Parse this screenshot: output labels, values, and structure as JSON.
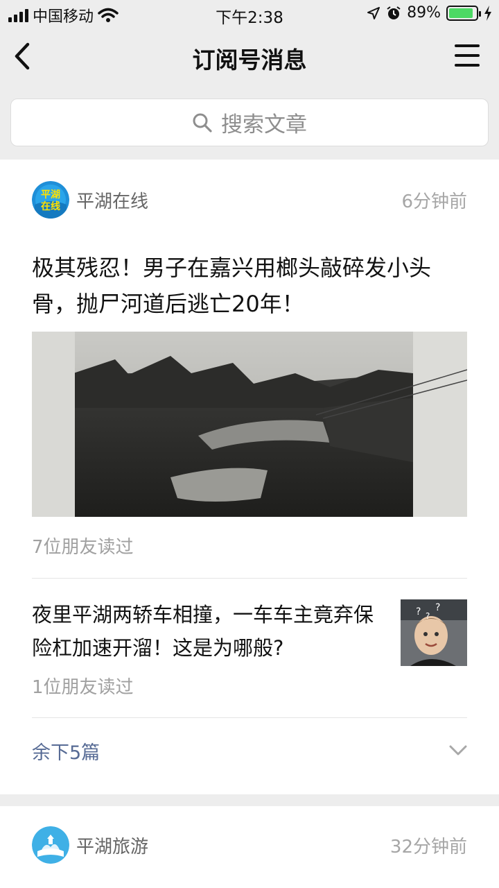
{
  "status_bar": {
    "carrier": "中国移动",
    "time": "下午2:38",
    "battery_percent": "89%",
    "battery_level": 0.89
  },
  "nav": {
    "title": "订阅号消息"
  },
  "search": {
    "placeholder": "搜索文章"
  },
  "feed": [
    {
      "account_name": "平湖在线",
      "time_ago": "6分钟前",
      "headline": "极其残忍！男子在嘉兴用榔头敲碎发小头骨，抛尸河道后逃亡20年！",
      "read_count": "7位朋友读过",
      "sub_article": {
        "title": "夜里平湖两轿车相撞，一车车主竟弃保险杠加速开溜！这是为哪般?",
        "read_count": "1位朋友读过"
      },
      "more_label": "余下5篇"
    },
    {
      "account_name": "平湖旅游",
      "time_ago": "32分钟前"
    }
  ],
  "icons": [
    "signal-icon",
    "wifi-icon",
    "location-icon",
    "alarm-icon",
    "battery-icon",
    "charging-icon",
    "back-icon",
    "menu-icon",
    "search-icon",
    "chevron-down-icon"
  ],
  "colors": {
    "background": "#ededed",
    "link": "#576b95",
    "battery": "#4cd964"
  }
}
